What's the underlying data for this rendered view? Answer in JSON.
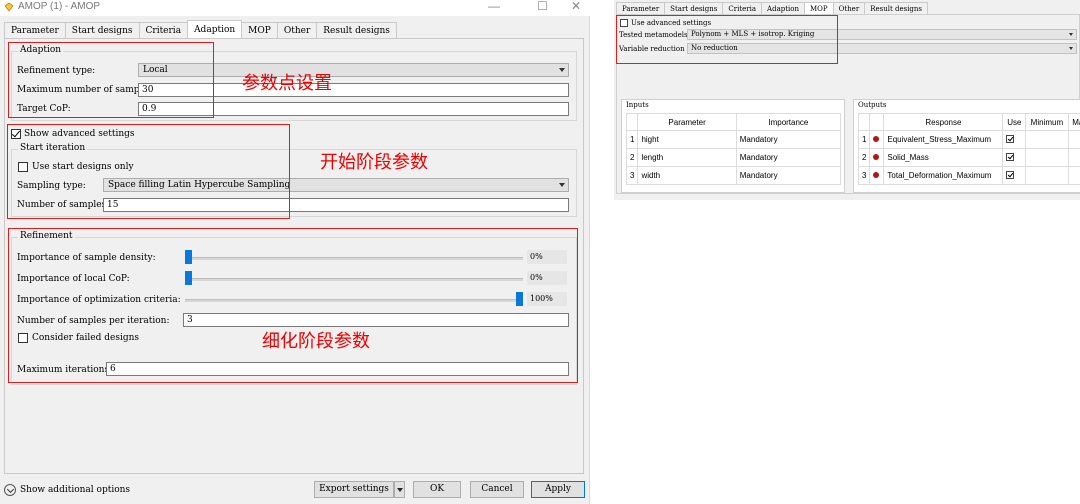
{
  "window": {
    "title": "AMOP (1) - AMOP",
    "minimize_glyph": "—",
    "maximize_glyph": "☐",
    "close_glyph": "✕",
    "icon": "diamond-icon"
  },
  "tabs": [
    "Parameter",
    "Start designs",
    "Criteria",
    "Adaption",
    "MOP",
    "Other",
    "Result designs"
  ],
  "active_tab": "Adaption",
  "adaption": {
    "group_title": "Adaption",
    "refinement_type_label": "Refinement type:",
    "refinement_type_value": "Local",
    "max_samples_label": "Maximum number of samples:",
    "max_samples_value": "30",
    "target_cop_label": "Target CoP:",
    "target_cop_value": "0.9"
  },
  "show_advanced": {
    "label": "Show advanced settings",
    "checked": true
  },
  "start_iteration": {
    "group_title": "Start iteration",
    "use_start_designs_label": "Use start designs only",
    "use_start_designs_checked": false,
    "sampling_type_label": "Sampling type:",
    "sampling_type_value": "Space filling Latin Hypercube Sampling",
    "num_samples_label": "Number of samples:",
    "num_samples_value": "15"
  },
  "refinement": {
    "group_title": "Refinement",
    "sliders": [
      {
        "label": "Importance of sample density:",
        "percent_text": "0%",
        "value": 0
      },
      {
        "label": "Importance of local CoP:",
        "percent_text": "0%",
        "value": 0
      },
      {
        "label": "Importance of optimization criteria:",
        "percent_text": "100%",
        "value": 100
      }
    ],
    "samples_per_iter_label": "Number of samples per iteration:",
    "samples_per_iter_value": "3",
    "consider_failed_label": "Consider failed designs",
    "consider_failed_checked": false,
    "max_iterations_label": "Maximum iterations:",
    "max_iterations_value": "6"
  },
  "annotations": {
    "adaption": "参数点设置",
    "start_iteration": "开始阶段参数",
    "refinement": "细化阶段参数",
    "color": "#f00000"
  },
  "bottom": {
    "show_additional_label": "Show additional options",
    "export_label": "Export settings",
    "ok_label": "OK",
    "cancel_label": "Cancel",
    "apply_label": "Apply"
  },
  "mop": {
    "tabs": [
      "Parameter",
      "Start designs",
      "Criteria",
      "Adaption",
      "MOP",
      "Other",
      "Result designs"
    ],
    "active_tab": "MOP",
    "use_advanced_label": "Use advanced settings",
    "use_advanced_checked": false,
    "tested_metamodels_label": "Tested metamodels",
    "tested_metamodels_value": "Polynom + MLS + isotrop. Kriging",
    "variable_reduction_label": "Variable reduction",
    "variable_reduction_value": "No reduction",
    "inputs": {
      "title": "Inputs",
      "headers": [
        "Parameter",
        "Importance"
      ],
      "rows": [
        {
          "num": "1",
          "parameter": "hight",
          "importance": "Mandatory"
        },
        {
          "num": "2",
          "parameter": "length",
          "importance": "Mandatory"
        },
        {
          "num": "3",
          "parameter": "width",
          "importance": "Mandatory"
        }
      ]
    },
    "outputs": {
      "title": "Outputs",
      "headers": [
        "Response",
        "Use",
        "Minimum",
        "Ma"
      ],
      "rows": [
        {
          "num": "1",
          "response": "Equivalent_Stress_Maximum"
        },
        {
          "num": "2",
          "response": "Solid_Mass"
        },
        {
          "num": "3",
          "response": "Total_Deformation_Maximum"
        }
      ]
    }
  }
}
